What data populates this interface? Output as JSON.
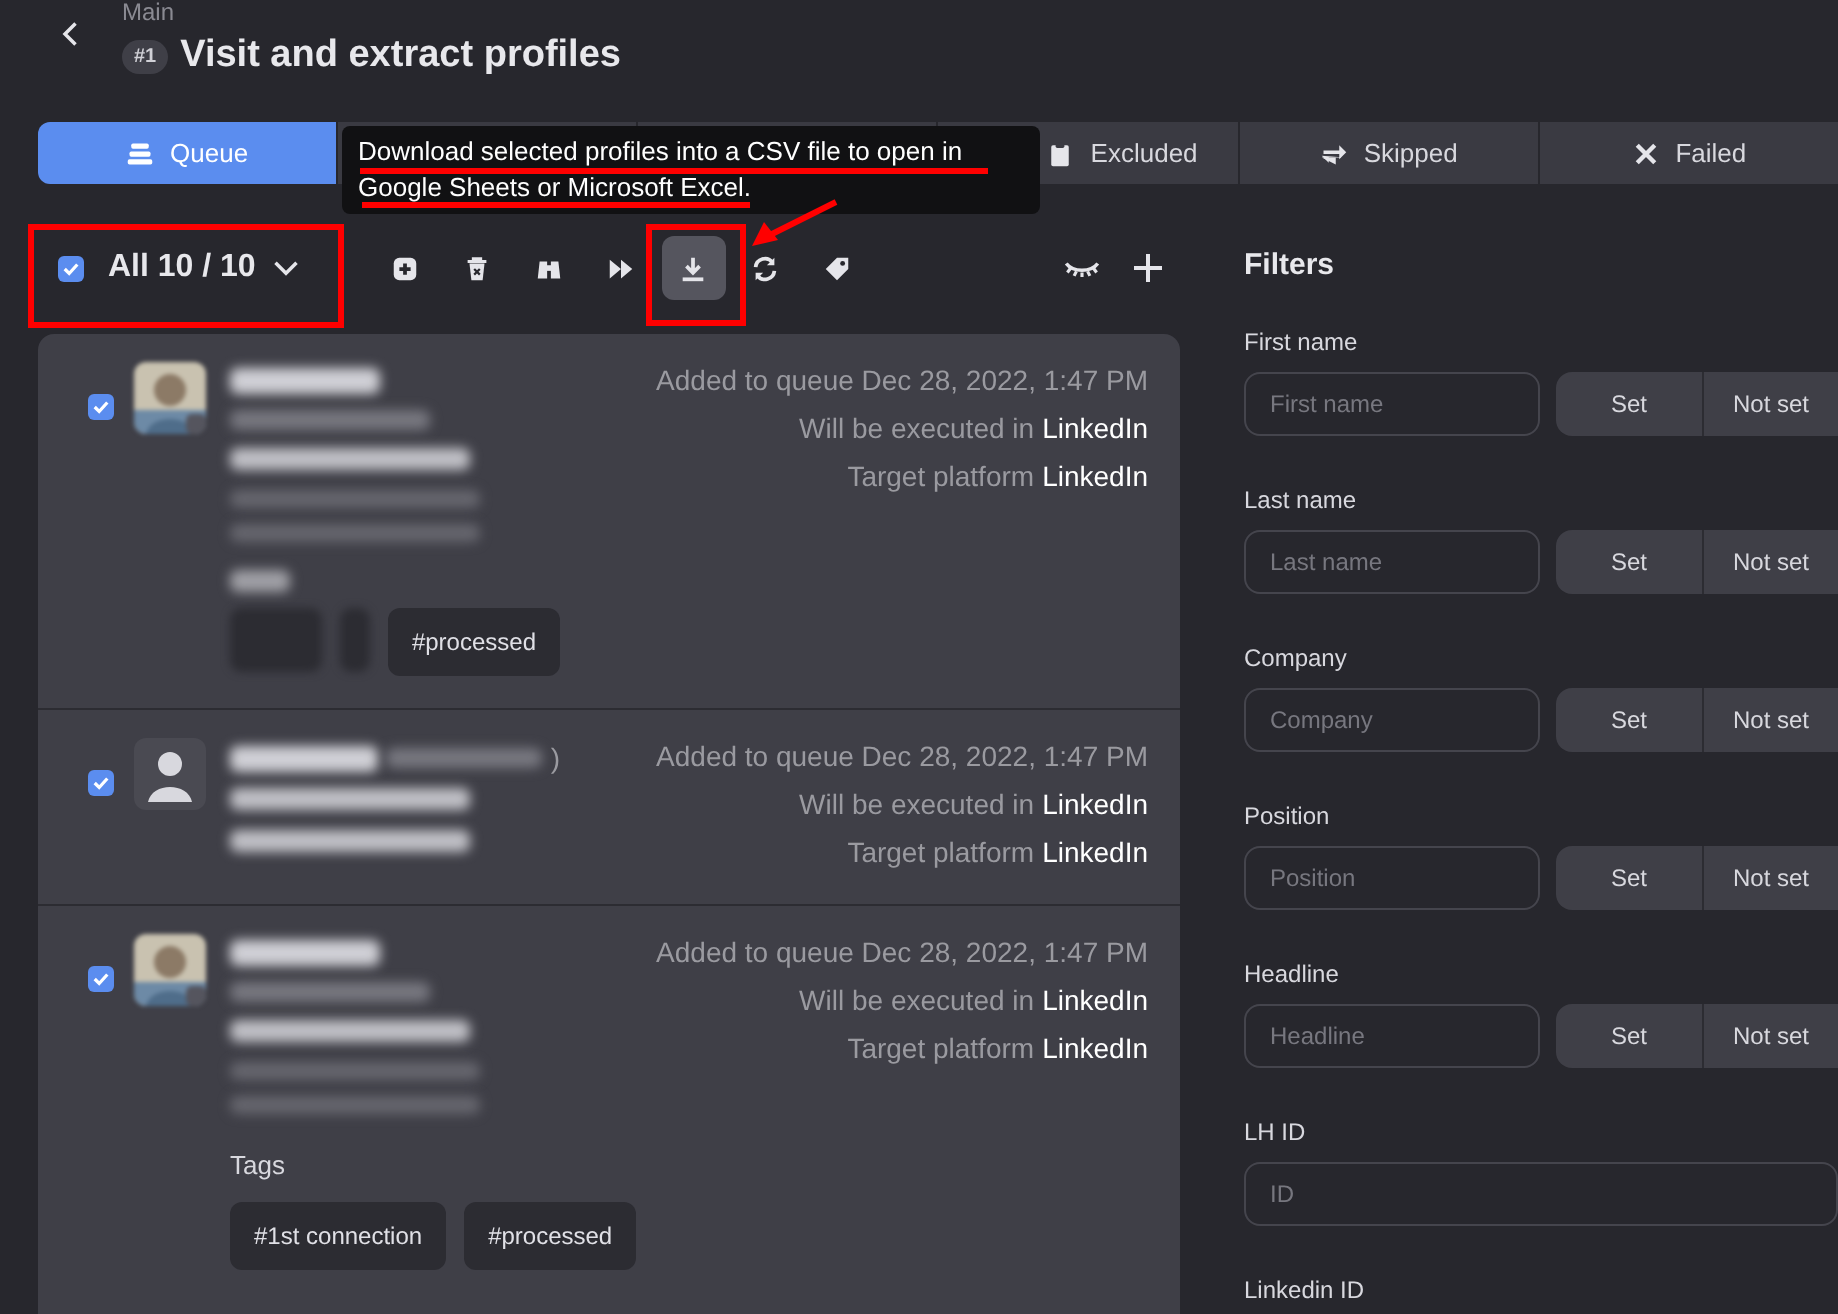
{
  "header": {
    "breadcrumb": "Main",
    "badge": "#1",
    "title": "Visit and extract profiles"
  },
  "tabs": [
    {
      "label": "Queue",
      "selected": true
    },
    {
      "selected": false
    },
    {
      "selected": false
    },
    {
      "label": "Excluded",
      "selected": false
    },
    {
      "label": "Skipped",
      "selected": false
    },
    {
      "label": "Failed",
      "selected": false
    }
  ],
  "tooltip": "Download selected profiles into a CSV file to open in Google Sheets or Microsoft Excel.",
  "select_all": {
    "checked": true,
    "label": "All 10 / 10"
  },
  "tools": [
    {
      "kind": "add",
      "selected": false
    },
    {
      "kind": "delete",
      "selected": false
    },
    {
      "kind": "binoculars",
      "selected": false
    },
    {
      "kind": "skip",
      "selected": false
    },
    {
      "kind": "download",
      "selected": true
    },
    {
      "kind": "sync",
      "selected": false
    },
    {
      "kind": "tag",
      "selected": false
    }
  ],
  "profiles": [
    {
      "checked": true,
      "added": "Added to queue Dec 28, 2022, 1:47 PM",
      "executed_label": "Will be executed in",
      "executed_value": "LinkedIn",
      "target_label": "Target platform",
      "target_value": "LinkedIn",
      "tags": [
        {
          "kind": "blurred"
        },
        {
          "kind": "blurred_small"
        },
        {
          "kind": "tag",
          "label": "#processed"
        }
      ]
    },
    {
      "checked": true,
      "kind": "placeholder",
      "name_suffix": ")",
      "added": "Added to queue Dec 28, 2022, 1:47 PM",
      "executed_label": "Will be executed in",
      "executed_value": "LinkedIn",
      "target_label": "Target platform",
      "target_value": "LinkedIn"
    },
    {
      "checked": true,
      "tags_label": "Tags",
      "added": "Added to queue Dec 28, 2022, 1:47 PM",
      "executed_label": "Will be executed in",
      "executed_value": "LinkedIn",
      "target_label": "Target platform",
      "target_value": "LinkedIn",
      "tags": [
        {
          "kind": "tag",
          "label": "#1st connection"
        },
        {
          "kind": "tag",
          "label": "#processed"
        }
      ]
    }
  ],
  "filters": {
    "title": "Filters",
    "items": [
      {
        "kind": "set",
        "label": "First name",
        "placeholder": "First name",
        "set": "Set",
        "not_set": "Not set"
      },
      {
        "kind": "set",
        "label": "Last name",
        "placeholder": "Last name",
        "set": "Set",
        "not_set": "Not set"
      },
      {
        "kind": "set",
        "label": "Company",
        "placeholder": "Company",
        "set": "Set",
        "not_set": "Not set"
      },
      {
        "kind": "set",
        "label": "Position",
        "placeholder": "Position",
        "set": "Set",
        "not_set": "Not set"
      },
      {
        "kind": "set",
        "label": "Headline",
        "placeholder": "Headline",
        "set": "Set",
        "not_set": "Not set"
      },
      {
        "kind": "plain",
        "label": "LH ID",
        "placeholder": "ID"
      },
      {
        "kind": "label_only",
        "label": "Linkedin ID"
      }
    ]
  }
}
